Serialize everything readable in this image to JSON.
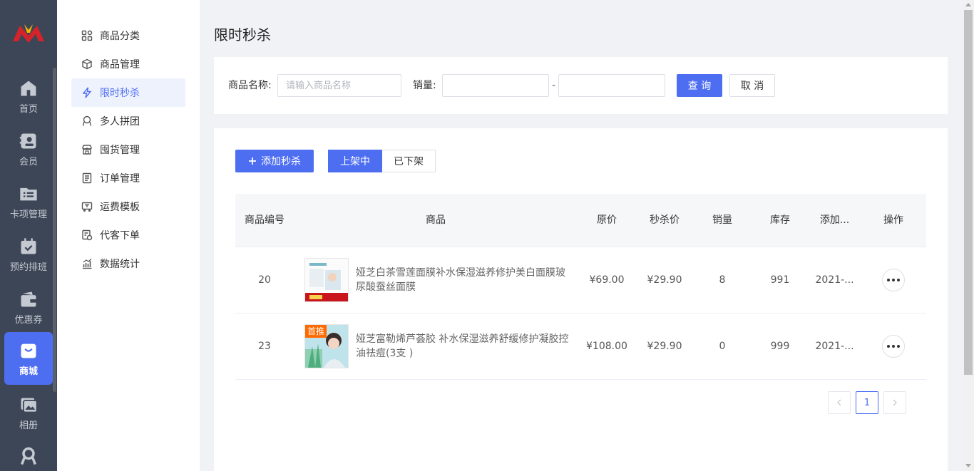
{
  "rail": {
    "items": [
      {
        "label": "首页",
        "icon": "home-icon"
      },
      {
        "label": "会员",
        "icon": "member-card-icon"
      },
      {
        "label": "卡项管理",
        "icon": "folder-list-icon"
      },
      {
        "label": "预约排班",
        "icon": "calendar-check-icon"
      },
      {
        "label": "优惠券",
        "icon": "wallet-icon"
      },
      {
        "label": "商城",
        "icon": "shopping-bag-icon",
        "active": true
      },
      {
        "label": "相册",
        "icon": "album-icon"
      }
    ]
  },
  "sidebar": {
    "items": [
      {
        "label": "商品分类",
        "icon": "grid-icon"
      },
      {
        "label": "商品管理",
        "icon": "cube-icon"
      },
      {
        "label": "限时秒杀",
        "icon": "flash-icon",
        "active": true
      },
      {
        "label": "多人拼团",
        "icon": "group-icon"
      },
      {
        "label": "囤货管理",
        "icon": "store-icon"
      },
      {
        "label": "订单管理",
        "icon": "order-icon"
      },
      {
        "label": "运费模板",
        "icon": "truck-icon"
      },
      {
        "label": "代客下单",
        "icon": "proxy-order-icon"
      },
      {
        "label": "数据统计",
        "icon": "chart-icon"
      }
    ]
  },
  "page": {
    "title": "限时秒杀"
  },
  "filter": {
    "name_label": "商品名称:",
    "name_placeholder": "请输入商品名称",
    "name_value": "",
    "sales_label": "销量:",
    "sales_min": "",
    "sales_max": "",
    "dash": "-",
    "query_label": "查 询",
    "cancel_label": "取 消"
  },
  "list": {
    "add_label": "添加秒杀",
    "tabs": [
      {
        "label": "上架中",
        "active": true
      },
      {
        "label": "已下架",
        "active": false
      }
    ],
    "columns": {
      "id": "商品编号",
      "goods": "商品",
      "orig": "原价",
      "sale": "秒杀价",
      "sold": "销量",
      "stock": "库存",
      "date": "添加...",
      "op": "操作"
    },
    "rows": [
      {
        "id": "20",
        "name": "娅芝白茶雪莲面膜补水保湿滋养修护美白面膜玻尿酸蚕丝面膜",
        "orig": "¥69.00",
        "sale": "¥29.90",
        "sold": "8",
        "stock": "991",
        "date": "2021-...",
        "badge": ""
      },
      {
        "id": "23",
        "name": "娅芝富勒烯芦荟胶 补水保湿滋养舒缓修护凝胶控油祛痘(3支 )",
        "orig": "¥108.00",
        "sale": "¥29.90",
        "sold": "0",
        "stock": "999",
        "date": "2021-...",
        "badge": "首推"
      }
    ],
    "pager": {
      "current": "1"
    }
  },
  "colors": {
    "primary": "#4e6ef2",
    "rail_bg": "#3d4656"
  }
}
